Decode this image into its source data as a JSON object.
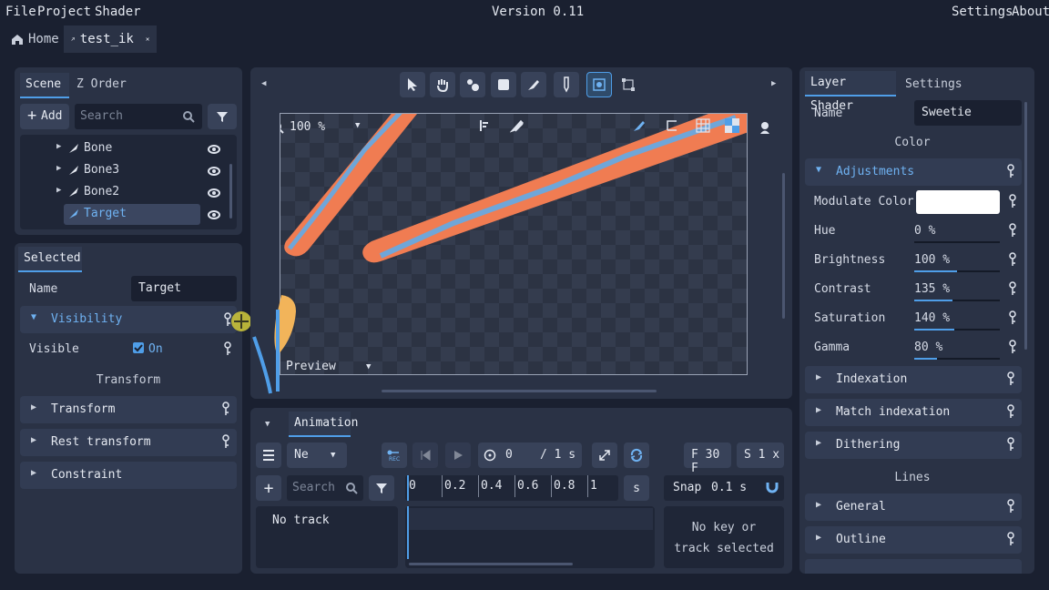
{
  "menu": {
    "file": "File",
    "project": "Project",
    "shader": "Shader",
    "version": "Version 0.11",
    "settings": "Settings",
    "about": "About"
  },
  "doc_tabs": [
    {
      "label": "Home"
    },
    {
      "label": "test_ik"
    }
  ],
  "scene": {
    "tabs": [
      "Scene",
      "Z Order"
    ],
    "add_label": "Add",
    "search_placeholder": "Search",
    "items": [
      {
        "label": "Bone"
      },
      {
        "label": "Bone3"
      },
      {
        "label": "Bone2"
      },
      {
        "label": "Target"
      }
    ]
  },
  "selected": {
    "tab": "Selected",
    "name_label": "Name",
    "name_value": "Target",
    "visibility_title": "Visibility",
    "visible_label": "Visible",
    "visible_value": "On",
    "transform_header": "Transform",
    "sections": [
      "Transform",
      "Rest transform",
      "Constraint"
    ]
  },
  "viewport": {
    "zoom": "100 %",
    "preview_label": "Preview"
  },
  "animation": {
    "tab": "Animation",
    "mode": "Ne",
    "time_current": "0",
    "time_total": "/ 1 s",
    "fps": "F 30 F",
    "speed": "S 1 x",
    "search_placeholder": "Search",
    "ruler_ticks": [
      "0",
      "0.2",
      "0.4",
      "0.6",
      "0.8",
      "1"
    ],
    "ruler_unit": "s",
    "snap_label": "Snap",
    "snap_value": "0.1 s",
    "no_track": "No track",
    "no_key": "No key or track selected"
  },
  "layer": {
    "tabs": [
      "Layer Shader",
      "Settings"
    ],
    "name_label": "Name",
    "name_value": "Sweetie",
    "color_header": "Color",
    "adjustments_title": "Adjustments",
    "modulate_label": "Modulate Color",
    "modulate_color": "#ffffff",
    "params": [
      {
        "label": "Hue",
        "value": "0 %",
        "fill": 0.0
      },
      {
        "label": "Brightness",
        "value": "100 %",
        "fill": 0.5
      },
      {
        "label": "Contrast",
        "value": "135 %",
        "fill": 0.45
      },
      {
        "label": "Saturation",
        "value": "140 %",
        "fill": 0.47
      },
      {
        "label": "Gamma",
        "value": "80 %",
        "fill": 0.27
      }
    ],
    "color_sections": [
      "Indexation",
      "Match indexation",
      "Dithering"
    ],
    "lines_header": "Lines",
    "line_sections": [
      "General",
      "Outline"
    ]
  },
  "colors": {
    "accent": "#4f9ee8",
    "bone_orange": "#f07c52",
    "bone_blue": "#6fa6d9",
    "bg": "#1a2030",
    "panel": "#2a3245"
  }
}
